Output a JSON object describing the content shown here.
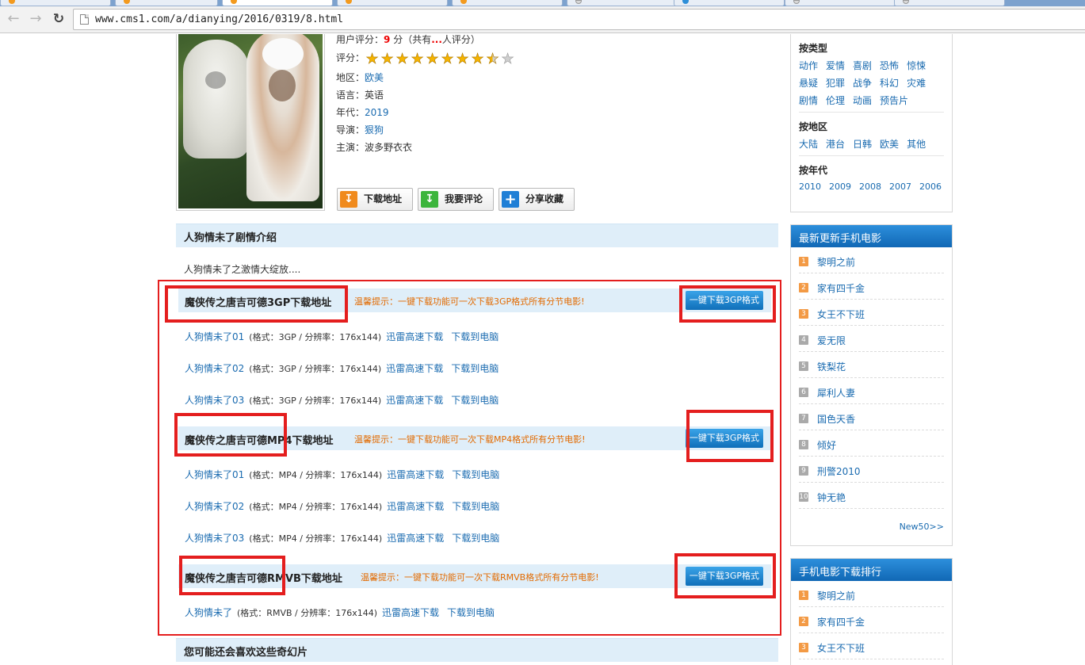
{
  "browser": {
    "url": "www.cms1.com/a/dianying/2016/0319/8.html"
  },
  "movie": {
    "rating_label": "用户评分：",
    "rating_value": "9",
    "rating_suffix": "分（共有",
    "rating_count": "...",
    "rating_tail": "人评分）",
    "stars_label": "评分：",
    "stars": 8.5,
    "stars_max": 10,
    "region_label": "地区：",
    "region": "欧美",
    "language_label": "语言：",
    "language": "英语",
    "year_label": "年代：",
    "year": "2019",
    "director_label": "导演：",
    "director": "狠狗",
    "cast_label": "主演：",
    "cast": "波多野衣衣"
  },
  "actions": {
    "download": "下载地址",
    "comment": "我要评论",
    "share": "分享收藏"
  },
  "plot": {
    "title": "人狗情未了剧情介绍",
    "text": "人狗情未了之激情大绽放...."
  },
  "download_sections": [
    {
      "title": "魔侠传之唐吉可德3GP下载地址",
      "tip": "温馨提示：一键下载功能可一次下载3GP格式所有分节电影!",
      "onekey": "一键下载3GP格式",
      "rows": [
        {
          "name": "人狗情未了01",
          "spec": "(格式：3GP / 分辨率：176x144)",
          "xunlei": "迅雷高速下载",
          "pc": "下载到电脑"
        },
        {
          "name": "人狗情未了02",
          "spec": "(格式：3GP / 分辨率：176x144)",
          "xunlei": "迅雷高速下载",
          "pc": "下载到电脑"
        },
        {
          "name": "人狗情未了03",
          "spec": "(格式：3GP / 分辨率：176x144)",
          "xunlei": "迅雷高速下载",
          "pc": "下载到电脑"
        }
      ]
    },
    {
      "title": "魔侠传之唐吉可德MP4下载地址",
      "tip": "温馨提示：一键下载功能可一次下载MP4格式所有分节电影!",
      "onekey": "一键下载3GP格式",
      "rows": [
        {
          "name": "人狗情未了01",
          "spec": "(格式：MP4 / 分辨率：176x144)",
          "xunlei": "迅雷高速下载",
          "pc": "下载到电脑"
        },
        {
          "name": "人狗情未了02",
          "spec": "(格式：MP4 / 分辨率：176x144)",
          "xunlei": "迅雷高速下载",
          "pc": "下载到电脑"
        },
        {
          "name": "人狗情未了03",
          "spec": "(格式：MP4 / 分辨率：176x144)",
          "xunlei": "迅雷高速下载",
          "pc": "下载到电脑"
        }
      ]
    },
    {
      "title": "魔侠传之唐吉可德RMVB下载地址",
      "tip": "温馨提示：一键下载功能可一次下载RMVB格式所有分节电影!",
      "onekey": "一键下载3GP格式",
      "rows": [
        {
          "name": "人狗情未了",
          "spec": "(格式：RMVB / 分辨率：176x144)",
          "xunlei": "迅雷高速下载",
          "pc": "下载到电脑"
        }
      ]
    }
  ],
  "related": {
    "title": "您可能还会喜欢这些奇幻片"
  },
  "sidebar": {
    "by_type_label": "按类型",
    "types": [
      "动作",
      "爱情",
      "喜剧",
      "恐怖",
      "惊悚",
      "悬疑",
      "犯罪",
      "战争",
      "科幻",
      "灾难",
      "剧情",
      "伦理",
      "动画",
      "预告片"
    ],
    "by_region_label": "按地区",
    "regions": [
      "大陆",
      "港台",
      "日韩",
      "欧美",
      "其他"
    ],
    "by_year_label": "按年代",
    "years": [
      "2010",
      "2009",
      "2008",
      "2007",
      "2006"
    ],
    "latest": {
      "title": "最新更新手机电影",
      "items": [
        "黎明之前",
        "家有四千金",
        "女王不下班",
        "爱无限",
        "铁梨花",
        "犀利人妻",
        "国色天香",
        "倾好",
        "刑警2010",
        "钟无艳"
      ],
      "more": "New50>>"
    },
    "top": {
      "title": "手机电影下载排行",
      "items": [
        "黎明之前",
        "家有四千金",
        "女王不下班"
      ]
    }
  },
  "colors": {
    "link": "#1a6bb0",
    "highlight_box": "#e41e1e",
    "section_bar": "#dfeef9",
    "tip": "#e26a00",
    "sidebar_head": "#1674c3"
  }
}
